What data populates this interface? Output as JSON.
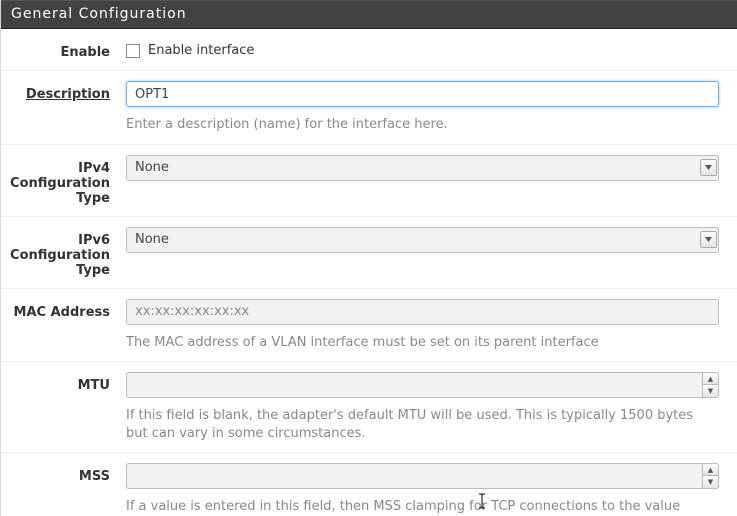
{
  "panel": {
    "title": "General Configuration"
  },
  "fields": {
    "enable": {
      "label": "Enable",
      "checkbox_label": "Enable interface"
    },
    "description": {
      "label": "Description",
      "value": "OPT1",
      "help": "Enter a description (name) for the interface here."
    },
    "ipv4": {
      "label": "IPv4 Configuration Type",
      "value": "None"
    },
    "ipv6": {
      "label": "IPv6 Configuration Type",
      "value": "None"
    },
    "mac": {
      "label": "MAC Address",
      "placeholder": "xx:xx:xx:xx:xx:xx",
      "value": "",
      "help": "The MAC address of a VLAN interface must be set on its parent interface"
    },
    "mtu": {
      "label": "MTU",
      "value": "",
      "help": "If this field is blank, the adapter's default MTU will be used. This is typically 1500 bytes but can vary in some circumstances."
    },
    "mss": {
      "label": "MSS",
      "value": "",
      "help": "If a value is entered in this field, then MSS clamping for TCP connections to the value"
    }
  }
}
